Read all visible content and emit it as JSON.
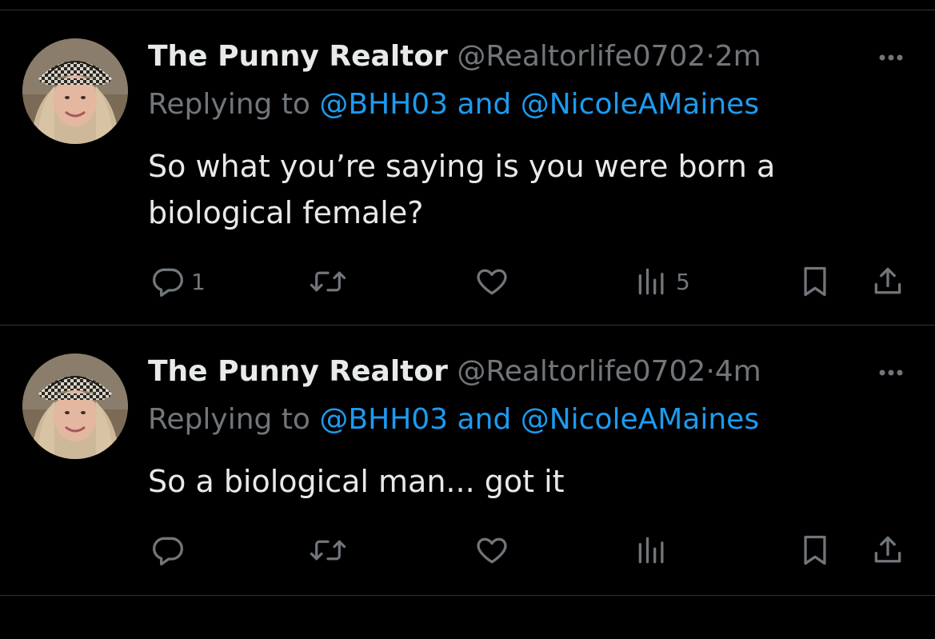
{
  "tweets": [
    {
      "display_name": "The Punny Realtor",
      "handle": "@Realtorlife0702",
      "separator": "·",
      "time": "2m",
      "replying_prefix": "Replying to",
      "mention_1": "@BHH03",
      "conjunction": "and",
      "mention_2": "@NicoleAMaines",
      "text": "So what you’re saying is you were born a biological female?",
      "reply_count": "1",
      "retweet_count": "",
      "like_count": "",
      "view_count": "5"
    },
    {
      "display_name": "The Punny Realtor",
      "handle": "@Realtorlife0702",
      "separator": "·",
      "time": "4m",
      "replying_prefix": "Replying to",
      "mention_1": "@BHH03",
      "conjunction": "and",
      "mention_2": "@NicoleAMaines",
      "text": "So a biological man... got it",
      "reply_count": "",
      "retweet_count": "",
      "like_count": "",
      "view_count": ""
    }
  ],
  "colors": {
    "background": "#000000",
    "primary_text": "#e7e9ea",
    "secondary_text": "#71767b",
    "link": "#1d9bf0",
    "divider": "#2f3336"
  },
  "icons": {
    "reply": "reply-icon",
    "retweet": "retweet-icon",
    "like": "heart-icon",
    "views": "views-icon",
    "bookmark": "bookmark-icon",
    "share": "share-icon",
    "more": "more-icon",
    "avatar": "avatar"
  }
}
